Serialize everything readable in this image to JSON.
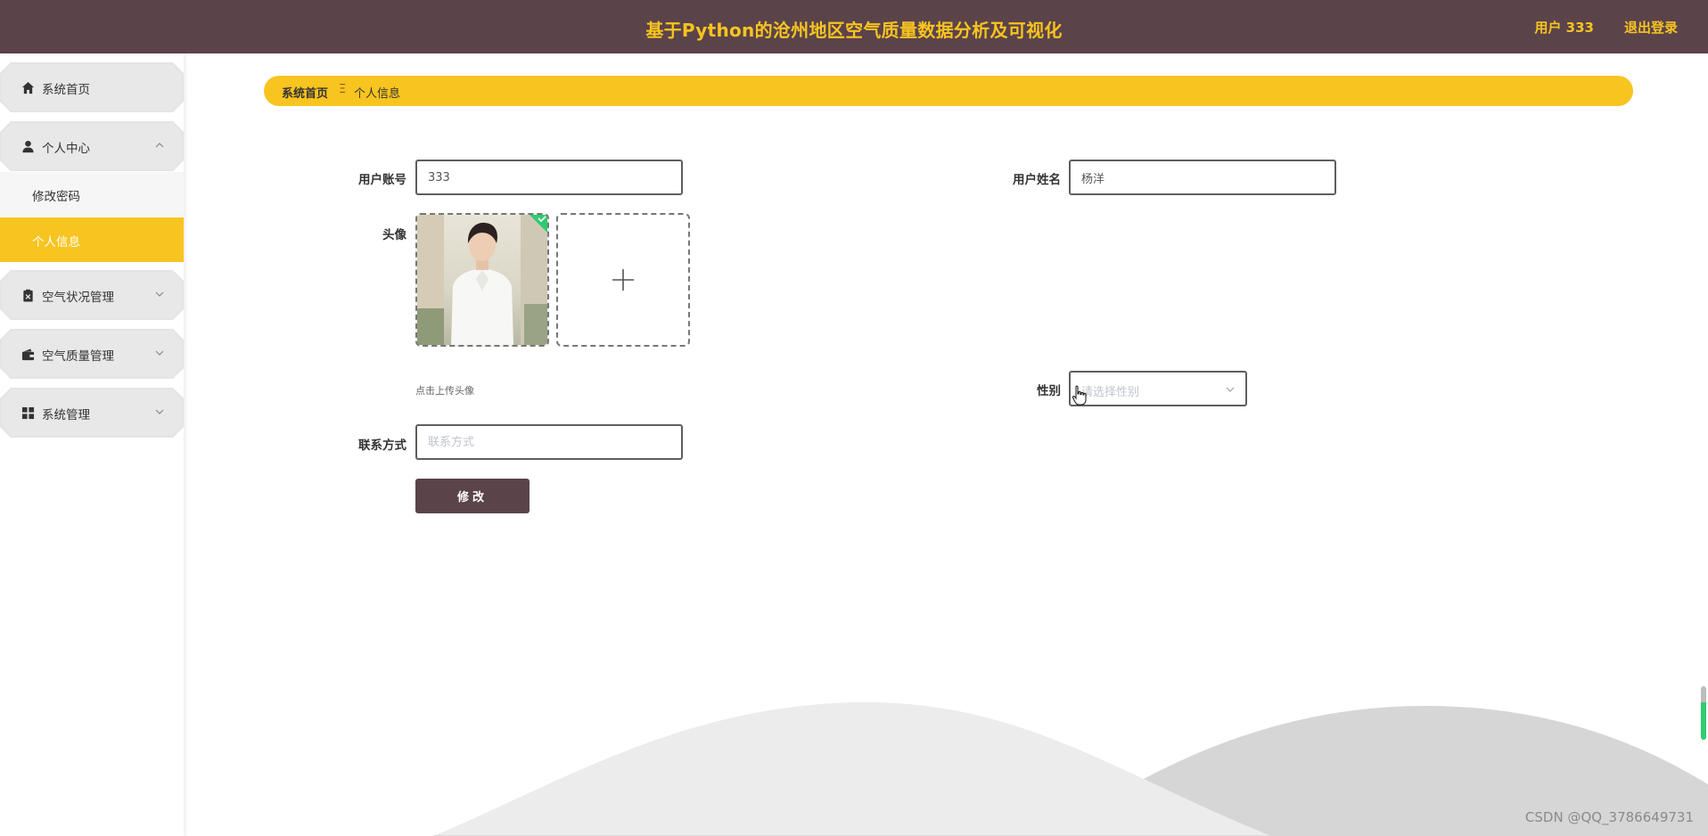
{
  "header": {
    "title": "基于Python的沧州地区空气质量数据分析及可视化",
    "user_label": "用户 333",
    "logout_label": "退出登录"
  },
  "sidebar": {
    "items": [
      {
        "label": "系统首页",
        "icon": "home-icon"
      },
      {
        "label": "个人中心",
        "icon": "user-icon",
        "expanded": true,
        "children": [
          {
            "label": "修改密码",
            "active": false
          },
          {
            "label": "个人信息",
            "active": true
          }
        ]
      },
      {
        "label": "空气状况管理",
        "icon": "clipboard-icon"
      },
      {
        "label": "空气质量管理",
        "icon": "wallet-icon"
      },
      {
        "label": "系统管理",
        "icon": "grid-icon"
      }
    ]
  },
  "breadcrumb": {
    "home": "系统首页",
    "separator": "Ξ",
    "current": "个人信息"
  },
  "form": {
    "account_label": "用户账号",
    "account_value": "333",
    "name_label": "用户姓名",
    "name_value": "杨洋",
    "avatar_label": "头像",
    "upload_hint": "点击上传头像",
    "gender_label": "性别",
    "gender_placeholder": "请选择性别",
    "phone_label": "联系方式",
    "phone_placeholder": "联系方式",
    "submit_label": "修改"
  },
  "watermark": "CSDN @QQ_3786649731",
  "colors": {
    "header_bg": "#5b434a",
    "accent": "#f8c41f",
    "button_bg": "#5b434a",
    "upload_badge": "#2ecc71"
  }
}
